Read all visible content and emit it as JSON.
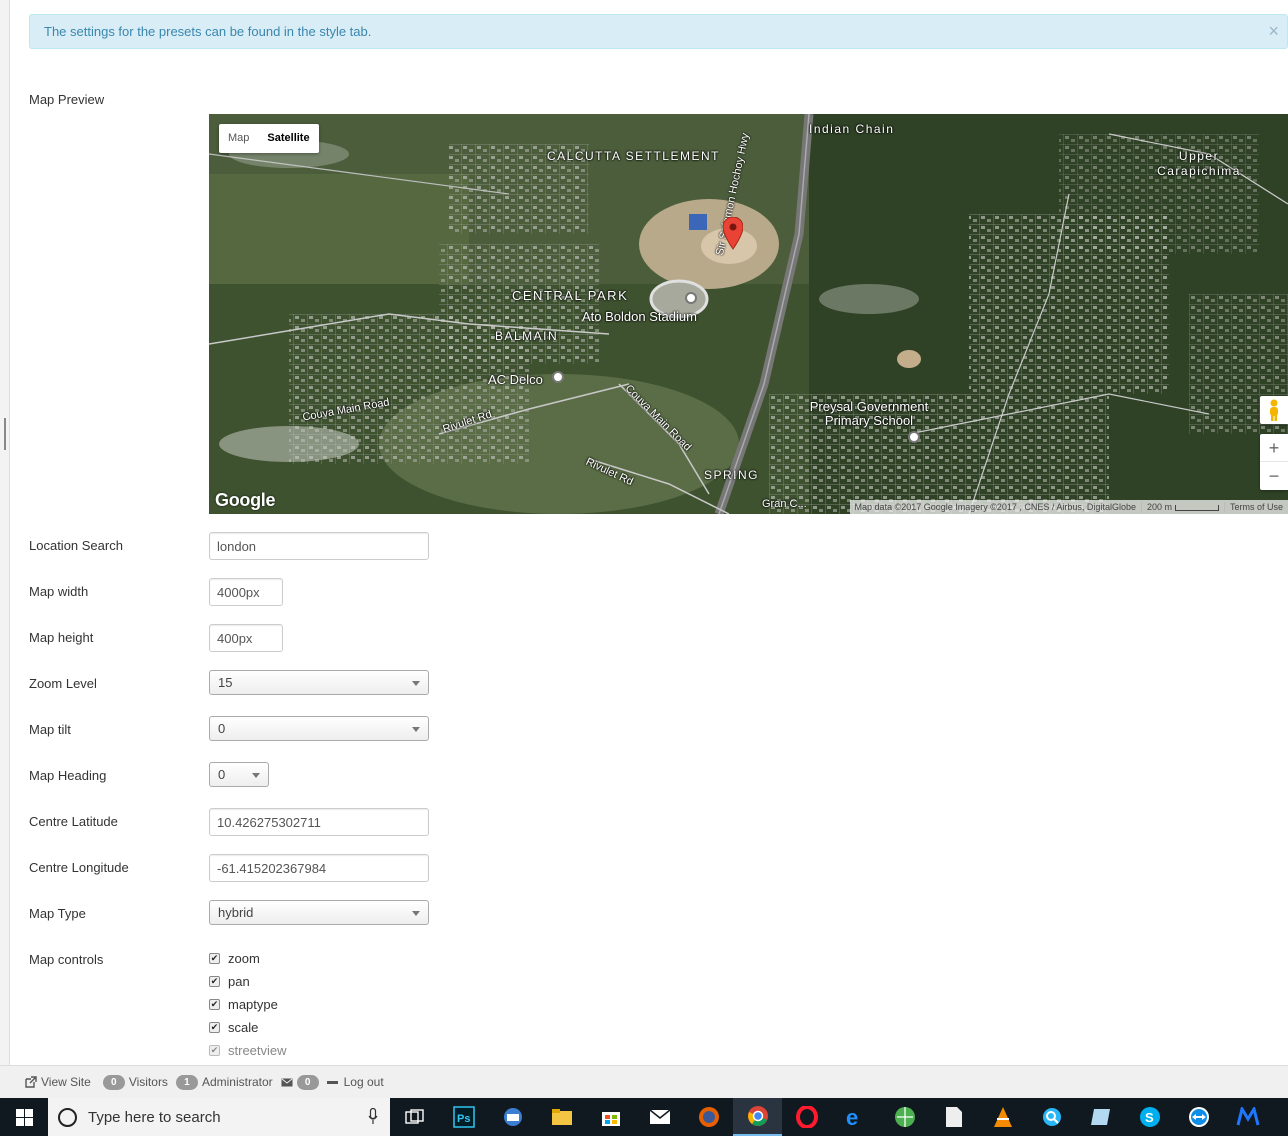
{
  "alert": {
    "message": "The settings for the presets can be found in the style tab.",
    "close": "×"
  },
  "map_preview": {
    "label": "Map Preview",
    "maptype_buttons": [
      "Map",
      "Satellite"
    ],
    "active_maptype": "Satellite",
    "place_labels": {
      "calcutta": "CALCUTTA SETTLEMENT",
      "indian_chain": "Indian Chain",
      "upper_carapichima": "Upper Carapichima",
      "central_park": "CENTRAL PARK",
      "stadium": "Ato Boldon Stadium",
      "balmain": "BALMAIN",
      "ac_delco": "AC Delco",
      "couva_main_rd_1": "Couva Main Road",
      "rivulet_rd_1": "Rivulet Rd",
      "couva_main_rd_2": "Couva Main Road",
      "rivulet_rd_2": "Rivulet Rd",
      "highway": "Sir Solomon Hochoy Hwy",
      "preysal": "Preysal Government Primary School",
      "spring": "SPRING",
      "gran": "Gran C..."
    },
    "logo": "Google",
    "attribution": "Map data ©2017 Google Imagery ©2017 , CNES / Airbus, DigitalGlobe",
    "scale": "200 m",
    "terms": "Terms of Use",
    "zoom_in": "+",
    "zoom_out": "−"
  },
  "form": {
    "location_search": {
      "label": "Location Search",
      "value": "london"
    },
    "map_width": {
      "label": "Map width",
      "value": "4000px"
    },
    "map_height": {
      "label": "Map height",
      "value": "400px"
    },
    "zoom_level": {
      "label": "Zoom Level",
      "value": "15"
    },
    "map_tilt": {
      "label": "Map tilt",
      "value": "0"
    },
    "map_heading": {
      "label": "Map Heading",
      "value": "0"
    },
    "centre_latitude": {
      "label": "Centre Latitude",
      "value": "10.426275302711"
    },
    "centre_longitude": {
      "label": "Centre Longitude",
      "value": "-61.415202367984"
    },
    "map_type": {
      "label": "Map Type",
      "value": "hybrid"
    },
    "map_controls": {
      "label": "Map controls",
      "options": [
        {
          "label": "zoom",
          "checked": true
        },
        {
          "label": "pan",
          "checked": true
        },
        {
          "label": "maptype",
          "checked": true
        },
        {
          "label": "scale",
          "checked": true
        },
        {
          "label": "streetview",
          "checked": true
        }
      ]
    }
  },
  "statusbar": {
    "view_site": "View Site",
    "visitors_count": "0",
    "visitors_label": "Visitors",
    "admin_count": "1",
    "admin_label": "Administrator",
    "messages_count": "0",
    "logout": "Log out"
  },
  "taskbar": {
    "search_placeholder": "Type here to search",
    "apps": [
      "task-view",
      "photoshop",
      "edge-mail",
      "file-explorer",
      "store",
      "mail",
      "firefox",
      "chrome",
      "opera",
      "edge",
      "earth",
      "notepad",
      "vlc",
      "magnifier",
      "notes",
      "skype",
      "teamviewer",
      "malwarebytes"
    ],
    "active_app": "chrome"
  },
  "colors": {
    "alert_bg": "#d9edf7",
    "alert_text": "#3a87ad",
    "marker": "#ea4335",
    "taskbar": "#101820"
  }
}
